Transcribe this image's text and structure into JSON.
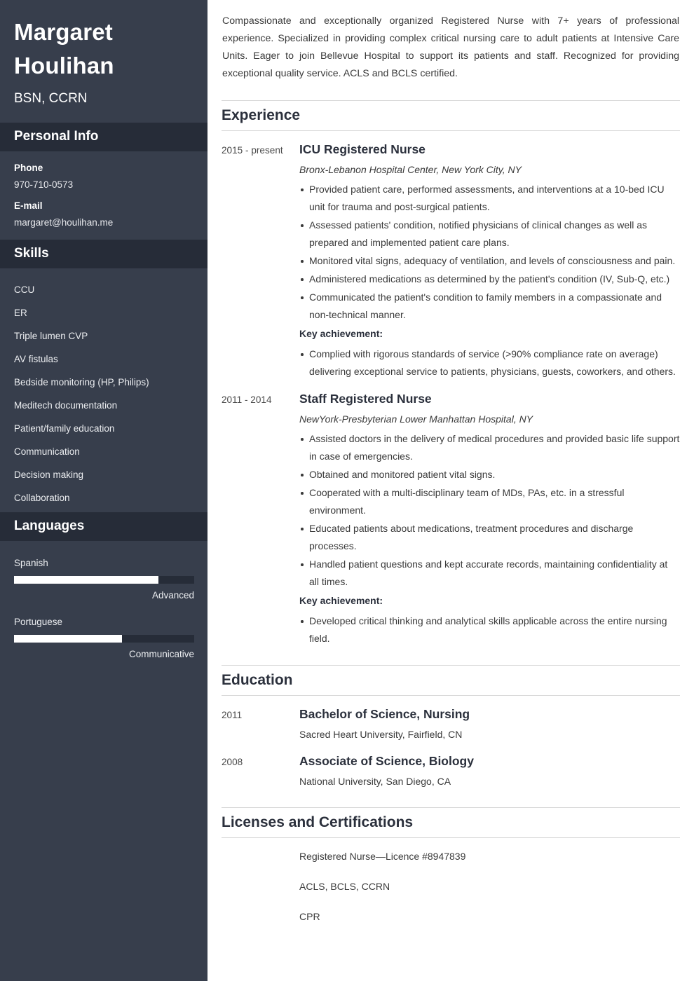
{
  "sidebar": {
    "name": "Margaret Houlihan",
    "credentials": "BSN, CCRN",
    "personal_info": {
      "heading": "Personal Info",
      "fields": [
        {
          "label": "Phone",
          "value": "970-710-0573"
        },
        {
          "label": "E-mail",
          "value": "margaret@houlihan.me"
        }
      ]
    },
    "skills": {
      "heading": "Skills",
      "items": [
        "CCU",
        "ER",
        "Triple lumen CVP",
        "AV fistulas",
        "Bedside monitoring (HP, Philips)",
        "Meditech documentation",
        "Patient/family education",
        "Communication",
        "Decision making",
        "Collaboration"
      ]
    },
    "languages": {
      "heading": "Languages",
      "items": [
        {
          "name": "Spanish",
          "level": "Advanced",
          "percent": 80
        },
        {
          "name": "Portuguese",
          "level": "Communicative",
          "percent": 60
        }
      ]
    }
  },
  "main": {
    "summary": "Compassionate and exceptionally organized Registered Nurse with 7+ years of professional experience. Specialized in providing complex critical nursing care to adult patients at Intensive Care Units. Eager to join Bellevue Hospital to support its patients and staff. Recognized for providing exceptional quality service. ACLS and BCLS certified.",
    "experience": {
      "heading": "Experience",
      "entries": [
        {
          "date": "2015 - present",
          "title": "ICU Registered Nurse",
          "subtitle": "Bronx-Lebanon Hospital Center, New York City, NY",
          "bullets": [
            "Provided patient care, performed assessments, and interventions at a 10-bed ICU unit for trauma and post-surgical patients.",
            "Assessed patients' condition, notified physicians of clinical changes as well as prepared and implemented patient care plans.",
            "Monitored vital signs, adequacy of ventilation, and levels of consciousness and pain.",
            "Administered medications as determined by the patient's condition (IV, Sub-Q, etc.)",
            "Communicated the patient's condition to family members in a compassionate and non-technical manner."
          ],
          "key_achievement_label": "Key achievement:",
          "key_achievements": [
            "Complied with rigorous standards of service (>90% compliance rate on average) delivering exceptional service to patients, physicians, guests, coworkers, and others."
          ]
        },
        {
          "date": "2011 - 2014",
          "title": "Staff Registered Nurse",
          "subtitle": "NewYork-Presbyterian Lower Manhattan Hospital, NY",
          "bullets": [
            "Assisted doctors in the delivery of medical procedures and provided basic life support in case of emergencies.",
            "Obtained and monitored patient vital signs.",
            "Cooperated with a multi-disciplinary team of MDs, PAs, etc. in a stressful environment.",
            "Educated patients about medications, treatment procedures and discharge processes.",
            "Handled patient questions and kept accurate records, maintaining confidentiality at all times."
          ],
          "key_achievement_label": "Key achievement:",
          "key_achievements": [
            "Developed critical thinking and analytical skills applicable across the entire nursing field."
          ]
        }
      ]
    },
    "education": {
      "heading": "Education",
      "entries": [
        {
          "date": "2011",
          "title": "Bachelor of Science, Nursing",
          "subtitle": "Sacred Heart University, Fairfield, CN"
        },
        {
          "date": "2008",
          "title": "Associate of Science, Biology",
          "subtitle": "National University, San Diego, CA"
        }
      ]
    },
    "certifications": {
      "heading": "Licenses and Certifications",
      "items": [
        "Registered Nurse—Licence #8947839",
        "ACLS, BCLS, CCRN",
        "CPR"
      ]
    }
  },
  "colors": {
    "sidebar_bg": "#373e4c",
    "sidebar_heading_bg": "#262c38",
    "text_dark": "#2b303c",
    "text_body": "#3a3a3a",
    "rule": "#d8d8d8"
  }
}
